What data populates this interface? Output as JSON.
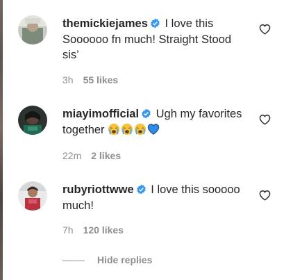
{
  "comments": [
    {
      "username": "themickiejames",
      "text": "I love this Soooooo fn much! Straight Stood sis’",
      "time": "3h",
      "likes": "55 likes"
    },
    {
      "username": "miayimofficial",
      "text": "Ugh my favorites together",
      "emojis": [
        "crying-face-emoji",
        "crying-face-emoji",
        "crying-face-emoji",
        "blue-heart-emoji"
      ],
      "time": "22m",
      "likes": "2 likes"
    },
    {
      "username": "rubyriottwwe",
      "text": "I love this sooooo much!",
      "time": "7h",
      "likes": "120 likes"
    }
  ],
  "hide_replies_label": "Hide replies",
  "colors": {
    "text": "#262626",
    "secondary": "#8e8e8e",
    "verified": "#3897f0"
  },
  "icons": {
    "like": "heart-outline-icon",
    "verified": "verified-badge-icon"
  }
}
